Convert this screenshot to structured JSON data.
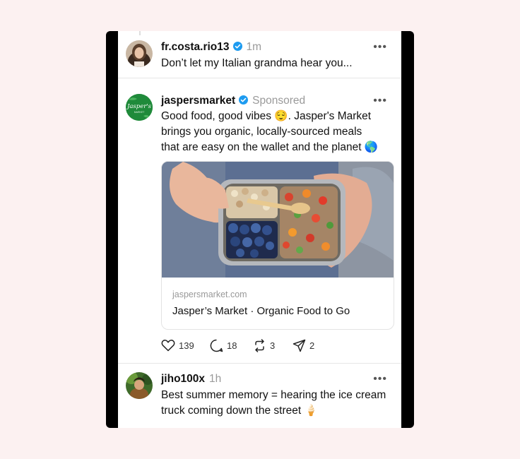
{
  "posts": [
    {
      "username": "fr.costa.rio13",
      "time": "1m",
      "text": "Don’t let my Italian grandma hear you..."
    },
    {
      "username": "jaspersmarket",
      "time": "Sponsored",
      "avatar_text": "Jasper's",
      "avatar_subtext": "MARKET",
      "text_line1": "Good food, good vibes 😌. Jasper's Market",
      "text_line2": "brings you organic, locally-sourced meals",
      "text_line3": "that are easy on the wallet and the planet 🌎",
      "card_domain": "jaspersmarket.com",
      "card_title": "Jasper’s Market · Organic Food to Go",
      "likes": "139",
      "replies": "18",
      "reposts": "3",
      "shares": "2"
    },
    {
      "username": "jiho100x",
      "time": "1h",
      "text_line1": "Best summer memory = hearing the ice cream",
      "text_line2": "truck coming down the street 🍦"
    }
  ],
  "more_label": "•••",
  "colors": {
    "verified": "#1d9bf0",
    "brand_green": "#1f8a3a",
    "background": "#fcf1f1"
  },
  "icons": [
    "verified-badge-icon",
    "more-icon",
    "heart-icon",
    "comment-icon",
    "repost-icon",
    "share-icon"
  ]
}
